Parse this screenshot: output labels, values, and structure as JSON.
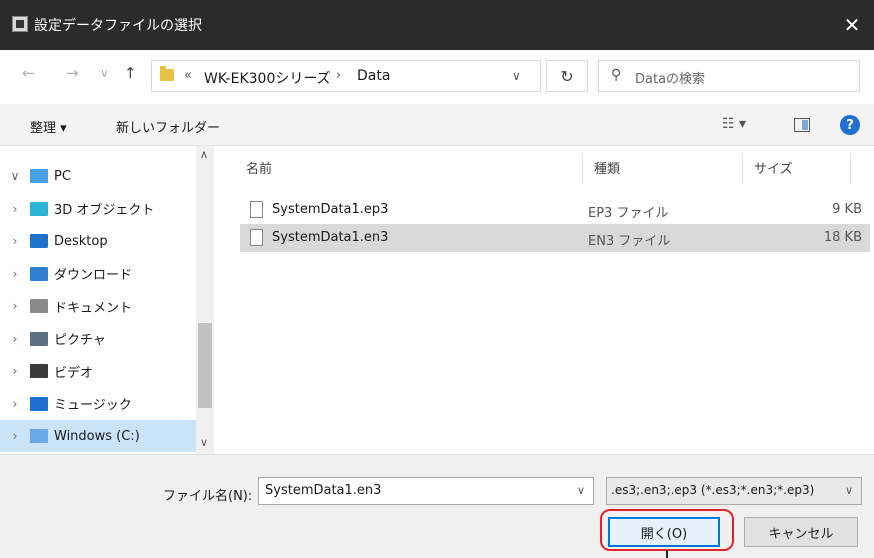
{
  "window": {
    "title": "設定データファイルの選択",
    "close_glyph": "✕"
  },
  "nav": {
    "back": "←",
    "forward": "→",
    "recent": "∨",
    "up": "↑",
    "breadcrumb": {
      "overflow": "«",
      "segments": [
        "WK-EK300シリーズ",
        "Data"
      ],
      "separator": "›"
    },
    "refresh": "↻",
    "search_placeholder": "Dataの検索"
  },
  "toolbar": {
    "organize": "整理 ▾",
    "new_folder": "新しいフォルダー"
  },
  "sidebar": {
    "items": [
      {
        "label": "PC",
        "arrow": "∨",
        "icon": "pc-icon",
        "color": "#4aa0e6"
      },
      {
        "label": "3D オブジェクト",
        "arrow": "›",
        "icon": "3d-objects-icon",
        "color": "#2bb3d4"
      },
      {
        "label": "Desktop",
        "arrow": "›",
        "icon": "desktop-icon",
        "color": "#1e73c8"
      },
      {
        "label": "ダウンロード",
        "arrow": "›",
        "icon": "download-icon",
        "color": "#2f7fd1"
      },
      {
        "label": "ドキュメント",
        "arrow": "›",
        "icon": "documents-icon",
        "color": "#8a8a8a"
      },
      {
        "label": "ピクチャ",
        "arrow": "›",
        "icon": "pictures-icon",
        "color": "#5b6e82"
      },
      {
        "label": "ビデオ",
        "arrow": "›",
        "icon": "videos-icon",
        "color": "#3a3a3a"
      },
      {
        "label": "ミュージック",
        "arrow": "›",
        "icon": "music-icon",
        "color": "#1e6fd1"
      },
      {
        "label": "Windows (C:)",
        "arrow": "›",
        "icon": "drive-icon",
        "color": "#6aa9e9"
      }
    ]
  },
  "file_list": {
    "columns": [
      "名前",
      "種類",
      "サイズ"
    ],
    "rows": [
      {
        "name": "SystemData1.ep3",
        "type": "EP3 ファイル",
        "size": "9 KB"
      },
      {
        "name": "SystemData1.en3",
        "type": "EN3 ファイル",
        "size": "18 KB"
      }
    ]
  },
  "footer": {
    "filename_label": "ファイル名(N):",
    "filename_value": "SystemData1.en3",
    "filter_value": ".es3;.en3;.ep3 (*.es3;*.en3;*.ep3)",
    "open_label": "開く(O)",
    "cancel_label": "キャンセル"
  },
  "colors": {
    "accent": "#0078d7",
    "highlight": "#e0242a",
    "selection": "#cce4f7"
  }
}
